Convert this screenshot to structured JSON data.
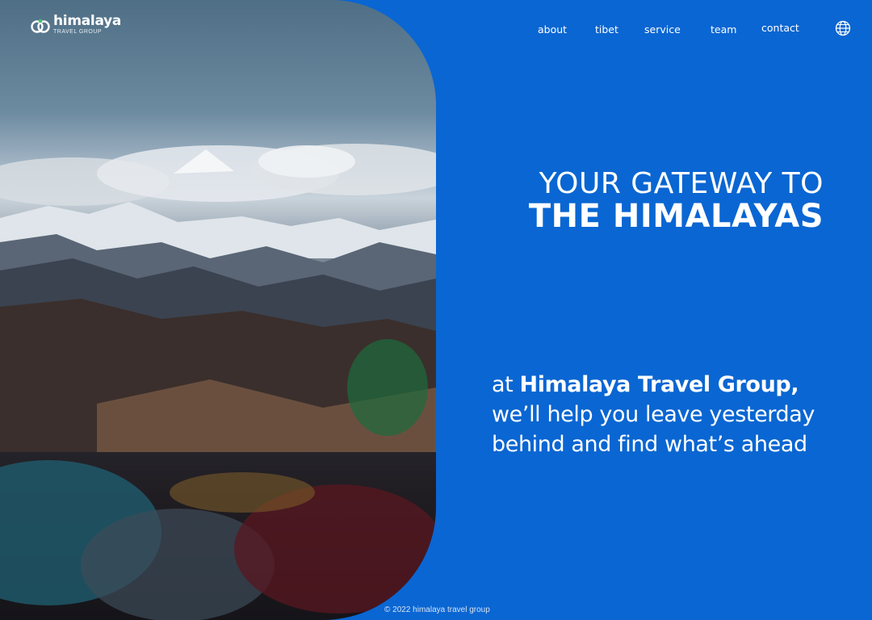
{
  "brand": {
    "name": "himalaya",
    "subtitle": "TRAVEL GROUP",
    "logo_icon": "interlocking-rings-logo"
  },
  "nav": {
    "items": [
      {
        "label": "about"
      },
      {
        "label": "tibet"
      },
      {
        "label": "service"
      },
      {
        "label": "team"
      },
      {
        "label": "contact"
      }
    ],
    "language_icon": "globe-icon"
  },
  "hero": {
    "image_alt": "snow-capped Himalayan mountains above clouds with prayer flags",
    "headline_line1": "YOUR GATEWAY TO",
    "headline_line2": "THE HIMALAYAS",
    "tagline_prefix": "at ",
    "tagline_brand": "Himalaya Travel Group,",
    "tagline_line2": "we’ll help you leave yesterday",
    "tagline_line3": "behind and find what’s ahead"
  },
  "footer": {
    "copyright": "© 2022 himalaya travel group"
  },
  "colors": {
    "background": "#0a66d2",
    "text": "#ffffff",
    "logo_accent": "#3ec46d"
  }
}
